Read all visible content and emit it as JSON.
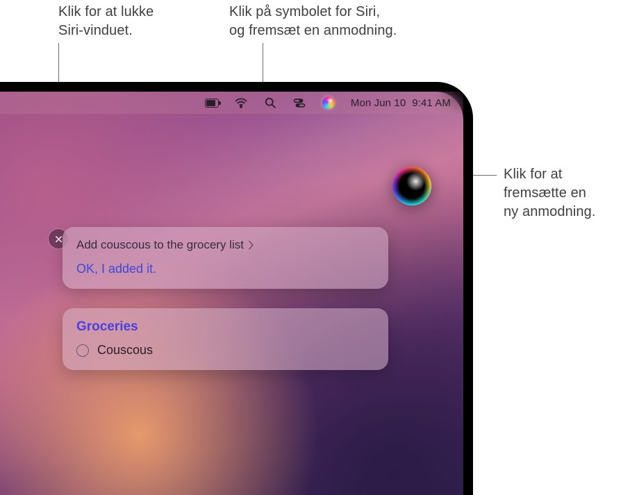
{
  "callouts": {
    "close": "Klik for at lukke\nSiri-vinduet.",
    "menubar_siri": "Klik på symbolet for Siri,\nog fremsæt en anmodning.",
    "orb": "Klik for at\nfremsætte en\nny anmodning."
  },
  "menubar": {
    "date": "Mon Jun 10",
    "time": "9:41 AM"
  },
  "siri": {
    "request": "Add couscous to the grocery list",
    "response": "OK, I added it.",
    "list": {
      "title": "Groceries",
      "items": [
        "Couscous"
      ]
    }
  }
}
